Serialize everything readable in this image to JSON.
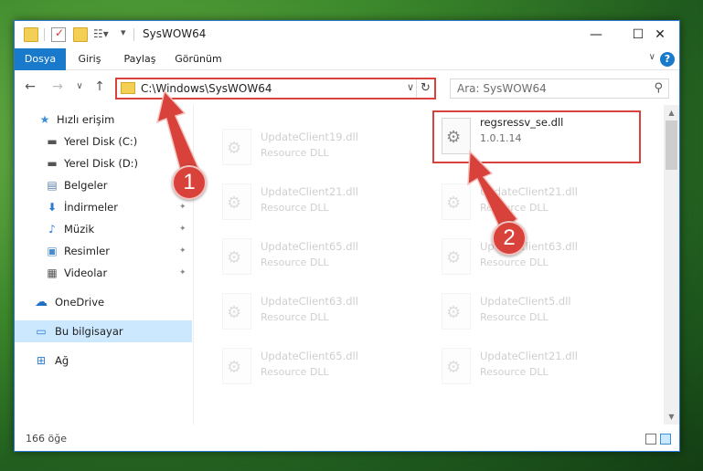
{
  "window": {
    "title": "SysWOW64",
    "controls": {
      "minimize": "—",
      "maximize": "☐",
      "close": "✕"
    }
  },
  "ribbon": {
    "tabs": [
      "Dosya",
      "Giriş",
      "Paylaş",
      "Görünüm"
    ],
    "help": "?"
  },
  "navigation": {
    "address": "C:\\Windows\\SysWOW64",
    "search_placeholder": "Ara: SysWOW64"
  },
  "sidebar": {
    "items": [
      {
        "label": "Hızlı erişim",
        "icon": "star-icon",
        "pinned": false
      },
      {
        "label": "Yerel Disk (C:)",
        "icon": "drive-icon",
        "pinned": true
      },
      {
        "label": "Yerel Disk (D:)",
        "icon": "drive-icon",
        "pinned": true
      },
      {
        "label": "Belgeler",
        "icon": "documents-icon",
        "pinned": true
      },
      {
        "label": "İndirmeler",
        "icon": "download-icon",
        "pinned": true
      },
      {
        "label": "Müzik",
        "icon": "music-icon",
        "pinned": true
      },
      {
        "label": "Resimler",
        "icon": "pictures-icon",
        "pinned": true
      },
      {
        "label": "Videolar",
        "icon": "videos-icon",
        "pinned": true
      },
      {
        "label": "OneDrive",
        "icon": "cloud-icon",
        "pinned": false
      },
      {
        "label": "Bu bilgisayar",
        "icon": "computer-icon",
        "pinned": false,
        "selected": true
      },
      {
        "label": "Ağ",
        "icon": "network-icon",
        "pinned": false
      }
    ]
  },
  "files": {
    "left_column": [
      {
        "name": "UpdateClient19.dll",
        "desc": "Resource DLL"
      },
      {
        "name": "UpdateClient21.dll",
        "desc": "Resource DLL"
      },
      {
        "name": "UpdateClient65.dll",
        "desc": "Resource DLL"
      },
      {
        "name": "UpdateClient63.dll",
        "desc": "Resource DLL"
      },
      {
        "name": "UpdateClient65.dll",
        "desc": "Resource DLL"
      }
    ],
    "right_column": [
      {
        "name": "regsressv_se.dll",
        "desc": "1.0.1.14",
        "highlighted": true
      },
      {
        "name": "UpdateClient21.dll",
        "desc": "Resource DLL"
      },
      {
        "name": "UpdateClient63.dll",
        "desc": "Resource DLL"
      },
      {
        "name": "UpdateClient5.dll",
        "desc": "Resource DLL"
      },
      {
        "name": "UpdateClient21.dll",
        "desc": "Resource DLL"
      }
    ]
  },
  "status": {
    "count": "166 öğe"
  },
  "callouts": {
    "one": "1",
    "two": "2"
  },
  "colors": {
    "accent": "#1979ca",
    "highlight": "#d9423a",
    "selection": "#cce8ff"
  }
}
